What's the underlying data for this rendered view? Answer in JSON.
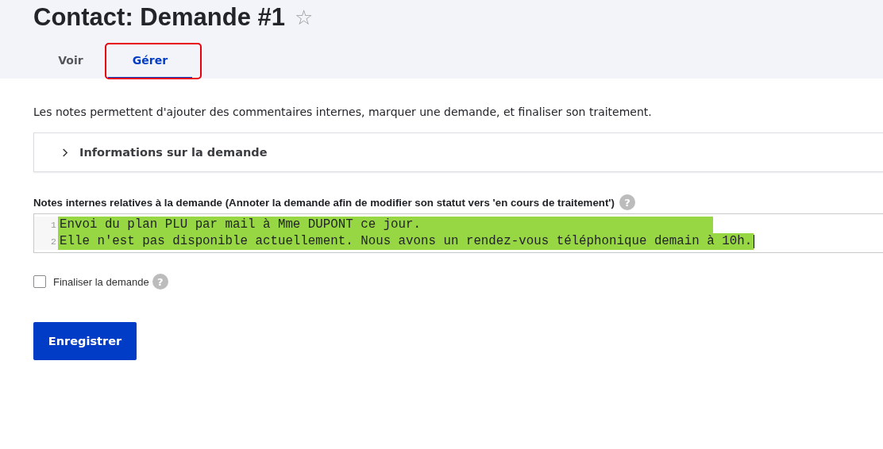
{
  "page": {
    "title": "Contact: Demande #1",
    "favorite_icon": "☆",
    "favorite": false
  },
  "tabs": [
    {
      "label": "Voir",
      "selected": false,
      "highlighted": false
    },
    {
      "label": "Gérer",
      "selected": true,
      "highlighted": true
    }
  ],
  "description": "Les notes permettent d'ajouter des commentaires internes, marquer une demande, et finaliser son traitement.",
  "accordion": {
    "label": "Informations sur la demande",
    "expanded": false
  },
  "notes": {
    "label": "Notes internes relatives à la demande (Annoter la demande afin de modifier son statut vers 'en cours de traitement')",
    "help": "?",
    "lines": [
      {
        "number": "1",
        "text": "Envoi du plan PLU par mail à Mme DUPONT ce jour.",
        "selected": true
      },
      {
        "number": "2",
        "text": "Elle n'est pas disponible actuellement. Nous avons un rendez-vous téléphonique demain à 10h.",
        "selected": true
      }
    ]
  },
  "finalize": {
    "label": "Finaliser la demande",
    "checked": false,
    "help": "?"
  },
  "save_button": "Enregistrer"
}
